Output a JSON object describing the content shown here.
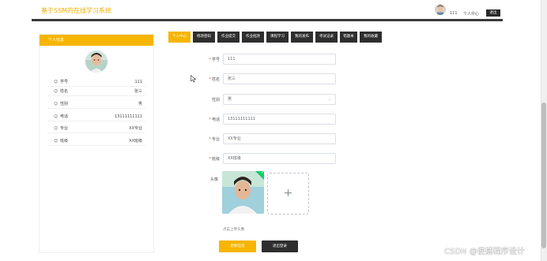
{
  "header": {
    "title": "基于SSM的在线学习系统",
    "username": "111",
    "user_center": "个人中心",
    "logout": "退出"
  },
  "side": {
    "heading": "个人信息",
    "rows": [
      {
        "icon": "user-icon",
        "label": "学号",
        "value": "111"
      },
      {
        "icon": "user-icon",
        "label": "姓名",
        "value": "张三"
      },
      {
        "icon": "user-icon",
        "label": "性别",
        "value": "男"
      },
      {
        "icon": "user-icon",
        "label": "电话",
        "value": "13111111111"
      },
      {
        "icon": "user-icon",
        "label": "专业",
        "value": "XX专业"
      },
      {
        "icon": "user-icon",
        "label": "班级",
        "value": "XX班级"
      }
    ]
  },
  "tabs": [
    {
      "label": "个人中心",
      "active": true
    },
    {
      "label": "修改密码",
      "active": false
    },
    {
      "label": "作业提交",
      "active": false
    },
    {
      "label": "作业批改",
      "active": false
    },
    {
      "label": "课程学习",
      "active": false
    },
    {
      "label": "我的发布",
      "active": false
    },
    {
      "label": "考试记录",
      "active": false
    },
    {
      "label": "错题本",
      "active": false
    },
    {
      "label": "我的收藏",
      "active": false
    }
  ],
  "form": {
    "fields": [
      {
        "label": "学号",
        "required": true,
        "value": "111"
      },
      {
        "label": "姓名",
        "required": true,
        "value": "张三"
      },
      {
        "label": "性别",
        "required": false,
        "value": "男",
        "type": "select"
      },
      {
        "label": "电话",
        "required": true,
        "value": "13111111111"
      },
      {
        "label": "专业",
        "required": true,
        "value": "XX专业"
      },
      {
        "label": "班级",
        "required": true,
        "value": "XX班级"
      }
    ],
    "avatar_label": "头像",
    "upload_tip": "点击上传头像",
    "update_button": "更新信息",
    "logout_button": "退出登录"
  },
  "watermark": "CSDN @便捷程序设计",
  "colors": {
    "accent": "#f7b500",
    "dark": "#2e2e2e"
  }
}
